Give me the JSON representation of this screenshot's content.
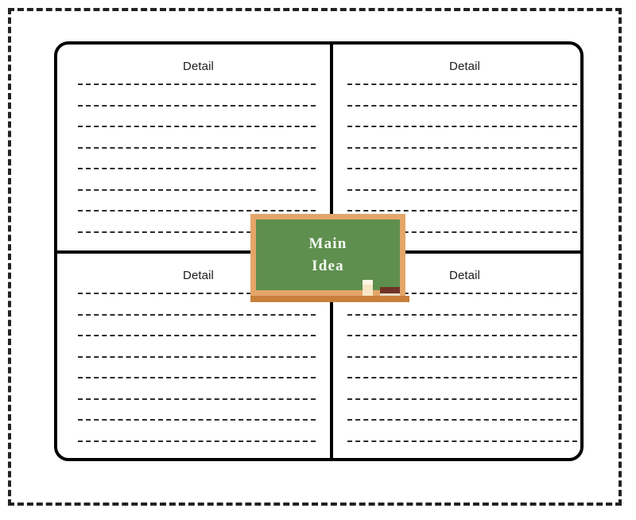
{
  "document": {
    "type": "graphic-organizer",
    "title_on_board": "Main Idea",
    "board_line_1": "Main",
    "board_line_2": "Idea"
  },
  "theme": {
    "board_green": "#5F8F4E",
    "frame_tan": "#E3A569",
    "ledge_brown": "#C97F3C",
    "outline_black": "#000000",
    "chalk_cream": "#F7E6C4",
    "eraser_brown": "#6F3425",
    "board_text_color": "#F3FBF3",
    "page_background": "#FFFFFF"
  },
  "quadrants": [
    {
      "id": "top-left",
      "label": "Detail",
      "line_count": 8
    },
    {
      "id": "top-right",
      "label": "Detail",
      "line_count": 8
    },
    {
      "id": "bottom-left",
      "label": "Detail",
      "line_count": 8
    },
    {
      "id": "bottom-right",
      "label": "Detail",
      "line_count": 8
    }
  ]
}
